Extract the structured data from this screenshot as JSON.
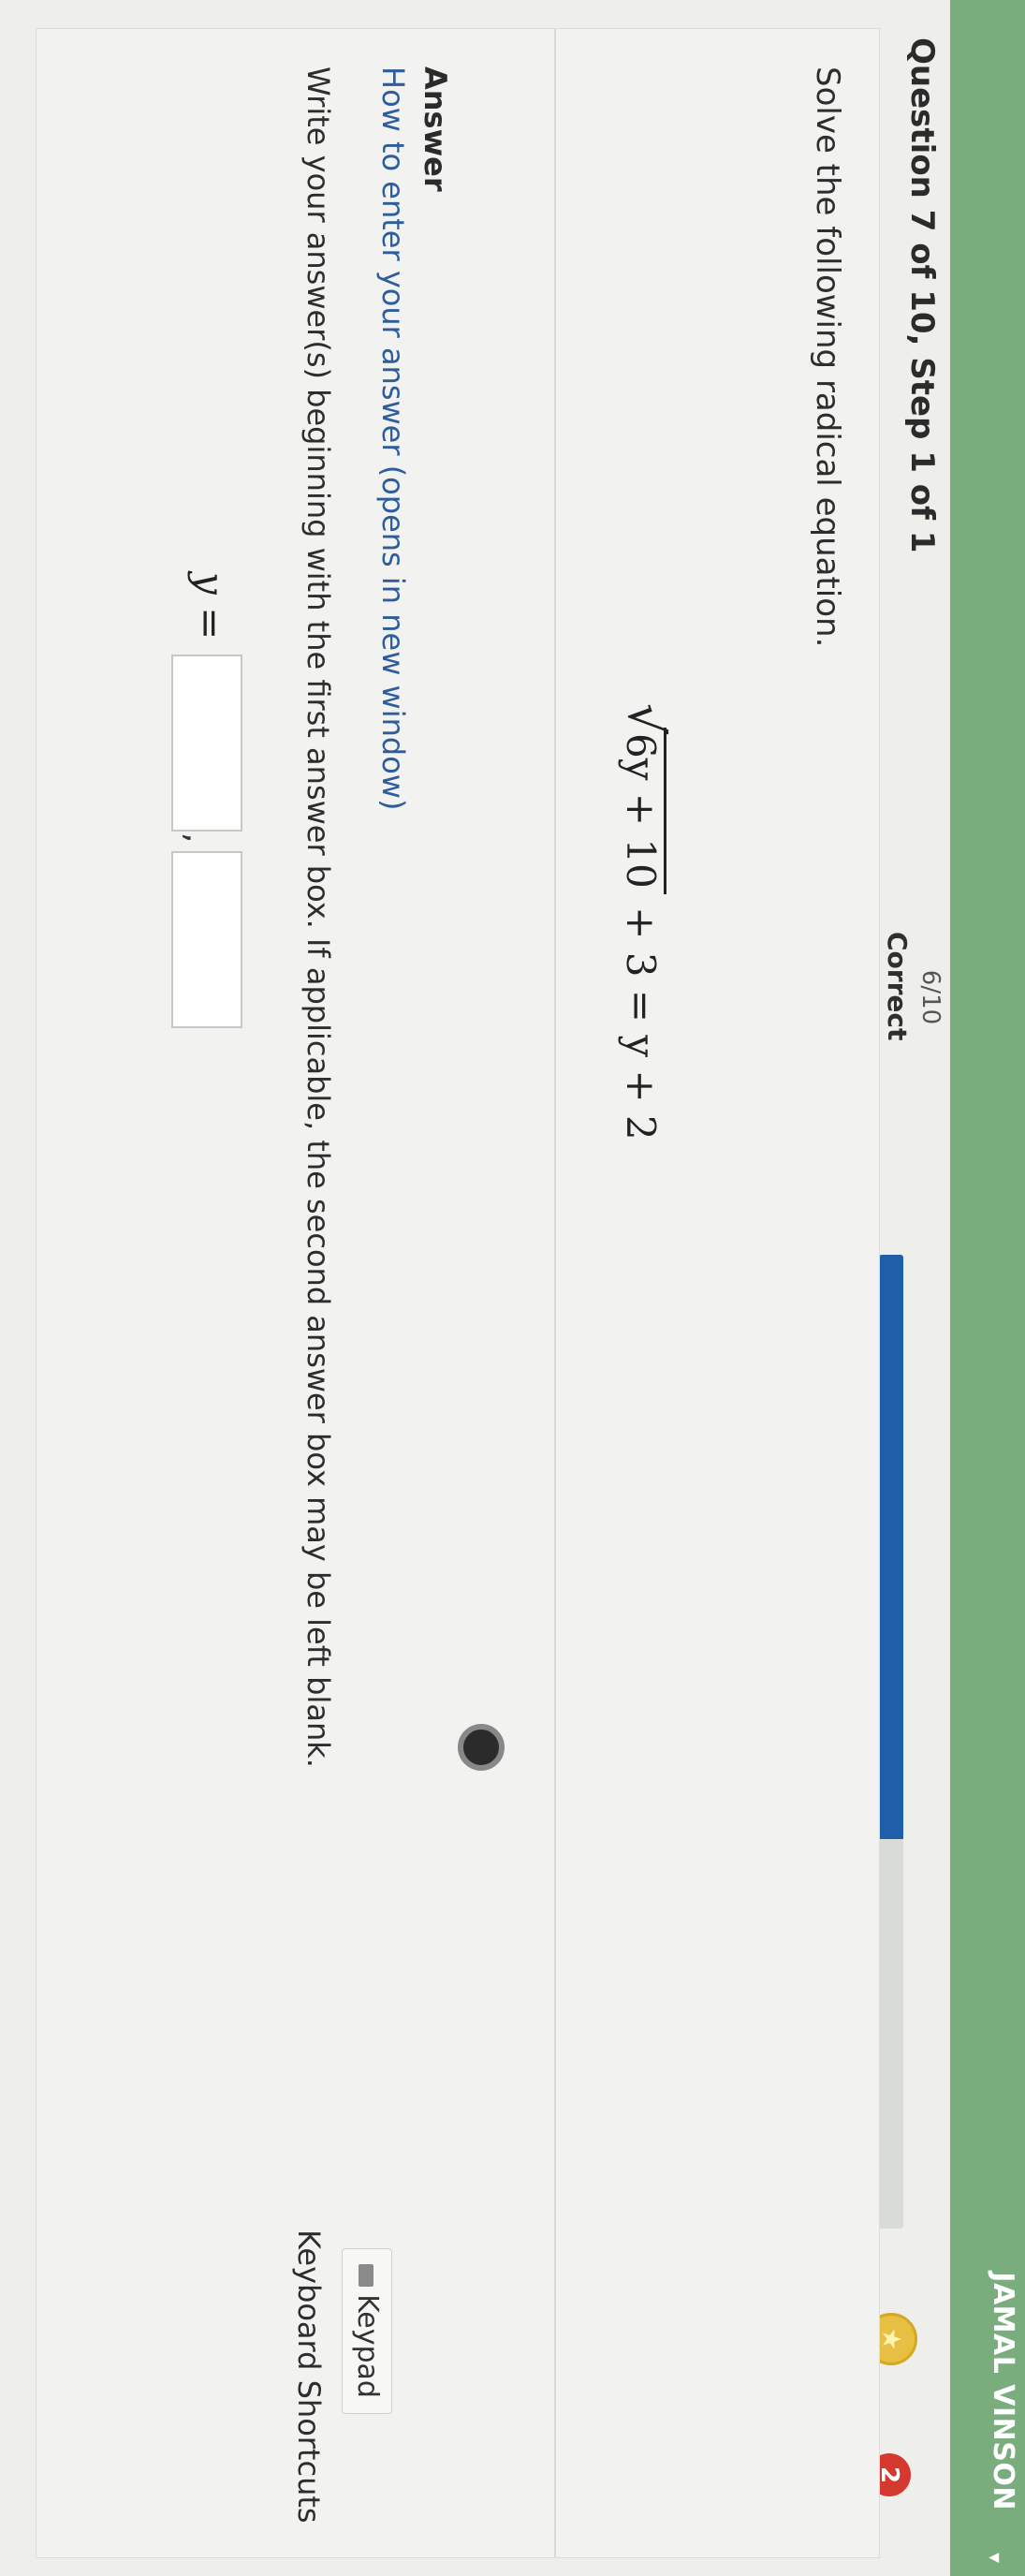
{
  "user": {
    "name": "JAMAL VINSON"
  },
  "header": {
    "question_title": "Question 7 of 10, Step 1 of 1",
    "score": "6/10",
    "status": "Correct",
    "progress_fraction": 0.6,
    "notification_count": "2"
  },
  "question": {
    "prompt": "Solve the following radical equation.",
    "equation": {
      "radicand": "6y + 10",
      "rest": "+ 3 = y + 2"
    }
  },
  "answer": {
    "heading": "Answer",
    "how_to_link": "How to enter your answer (opens in new window)",
    "keypad_label": "Keypad",
    "keyboard_shortcuts": "Keyboard Shortcuts",
    "instructions": "Write your answer(s) beginning with the first answer box. If applicable, the second answer box may be left blank.",
    "variable_label": "y =",
    "separator": ",",
    "box1_value": "",
    "box2_value": ""
  },
  "colors": {
    "accent_green": "#79ad7d",
    "progress_blue": "#1f5ea8",
    "link_blue": "#2d5d9c",
    "badge_red": "#d5382f"
  }
}
